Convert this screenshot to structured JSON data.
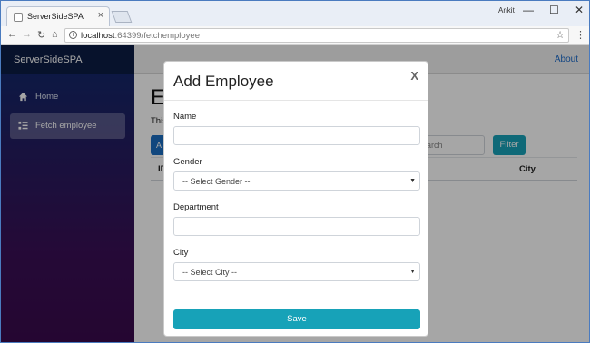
{
  "browser": {
    "tab_title": "ServerSideSPA",
    "tab_close": "×",
    "user_label": "Ankit",
    "url_host": "localhost",
    "url_path": ":64399/fetchemployee",
    "minimize": "—",
    "maximize": "☐",
    "close": "✕",
    "back": "←",
    "forward": "→",
    "reload": "↻",
    "home": "⌂",
    "star": "☆",
    "menu": "⋮",
    "info": "i"
  },
  "sidebar": {
    "brand": "ServerSideSPA",
    "items": [
      {
        "label": "Home",
        "icon": "home-icon"
      },
      {
        "label": "Fetch employee",
        "icon": "list-icon"
      }
    ]
  },
  "topbar": {
    "about": "About"
  },
  "page": {
    "title": "E",
    "subtitle": "This",
    "create_button": "A",
    "search_placeholder": "earch",
    "filter_button": "Filter",
    "columns": [
      "ID",
      "t",
      "City"
    ]
  },
  "modal": {
    "title": "Add Employee",
    "close": "X",
    "fields": [
      {
        "label": "Name",
        "type": "text",
        "value": ""
      },
      {
        "label": "Gender",
        "type": "select",
        "value": "-- Select Gender --"
      },
      {
        "label": "Department",
        "type": "text",
        "value": ""
      },
      {
        "label": "City",
        "type": "select",
        "value": "-- Select City --"
      }
    ],
    "save_button": "Save"
  },
  "colors": {
    "accent": "#17a2b8",
    "primary": "#1b6ec2",
    "sidebar_top": "#0f2a6c",
    "sidebar_bottom": "#3a0a4c"
  }
}
